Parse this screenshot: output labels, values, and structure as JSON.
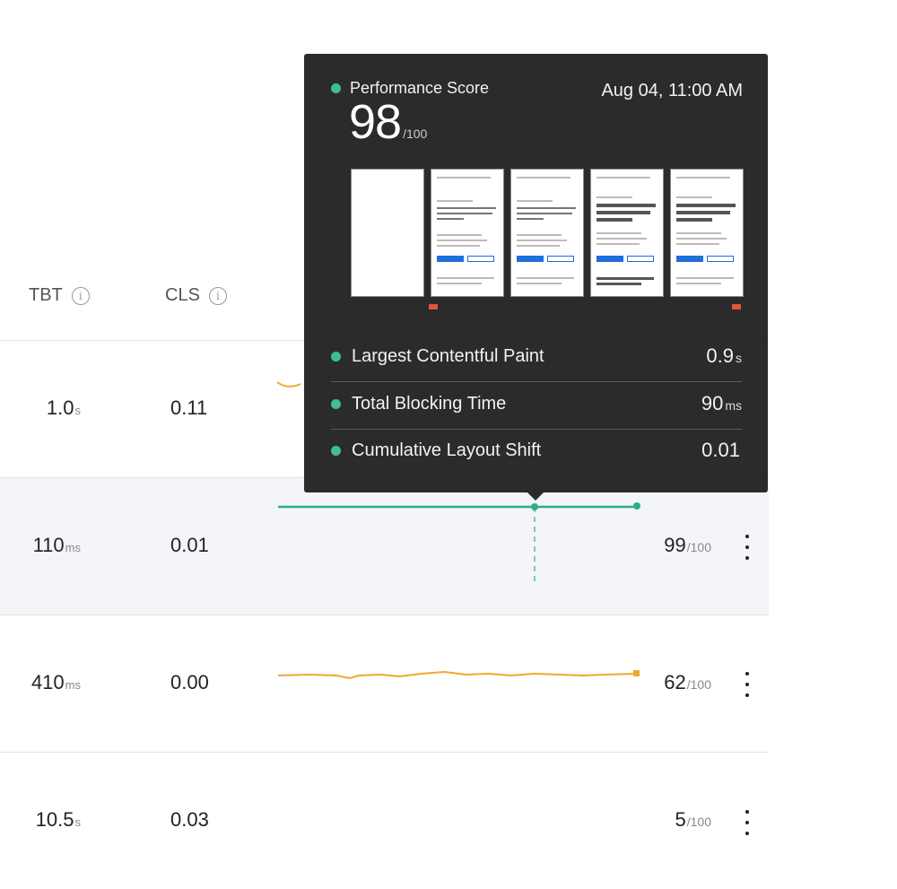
{
  "headers": {
    "tbt": "TBT",
    "cls": "CLS",
    "info_glyph": "i"
  },
  "rows": [
    {
      "tbt": "1.0",
      "tbt_unit": "s",
      "cls": "0.11",
      "score": "",
      "score_den": "",
      "spark_color": "#f0a830"
    },
    {
      "tbt": "110",
      "tbt_unit": "ms",
      "cls": "0.01",
      "score": "99",
      "score_den": "/100",
      "spark_color": "#2fae86",
      "highlighted": true
    },
    {
      "tbt": "410",
      "tbt_unit": "ms",
      "cls": "0.00",
      "score": "62",
      "score_den": "/100",
      "spark_color": "#f0a830"
    },
    {
      "tbt": "10.5",
      "tbt_unit": "s",
      "cls": "0.03",
      "score": "5",
      "score_den": "/100",
      "spark_color": "#f0a830"
    }
  ],
  "tooltip": {
    "title": "Performance Score",
    "date": "Aug 04, 11:00 AM",
    "score": "98",
    "score_den": "/100",
    "metrics": [
      {
        "label": "Largest Contentful Paint",
        "value": "0.9",
        "unit": "s"
      },
      {
        "label": "Total Blocking Time",
        "value": "90",
        "unit": "ms"
      },
      {
        "label": "Cumulative Layout Shift",
        "value": "0.01",
        "unit": ""
      }
    ]
  },
  "colors": {
    "good": "#3fbf8f",
    "warn": "#f0a830",
    "bad": "#e4533f",
    "tooltip_bg": "#2b2b2b"
  }
}
